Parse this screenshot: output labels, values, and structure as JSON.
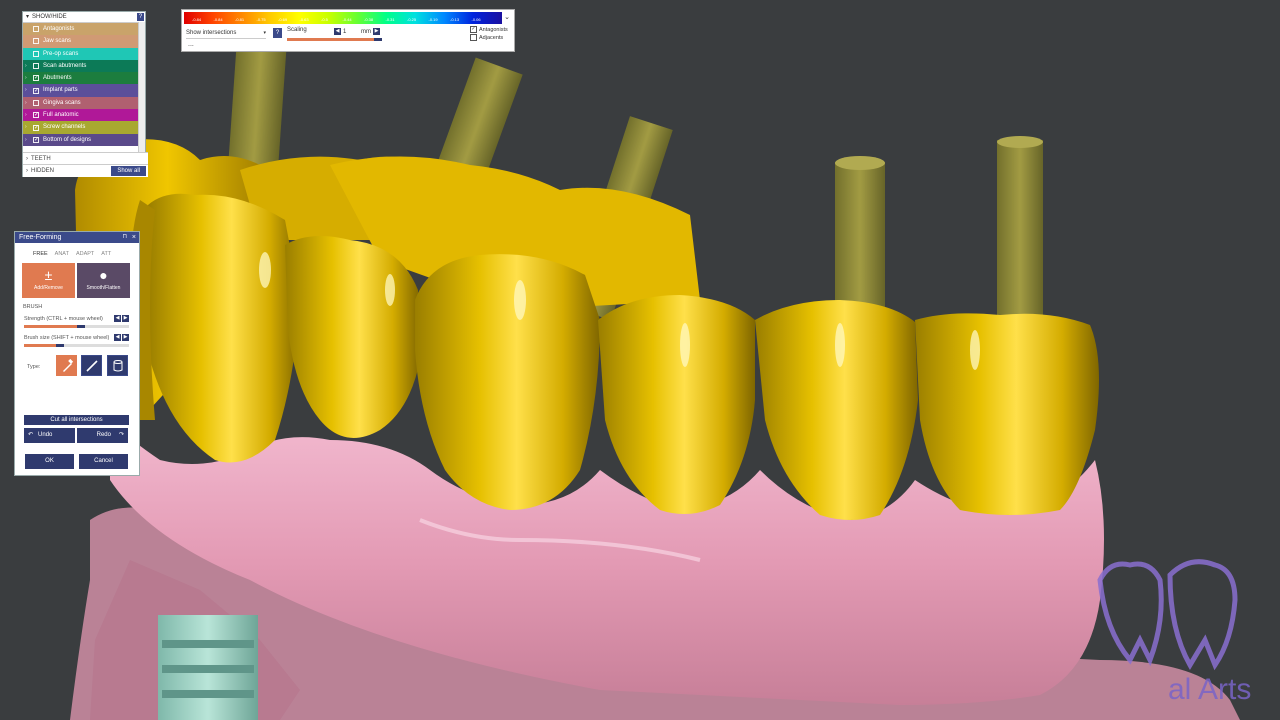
{
  "show_hide": {
    "title": "SHOW/HIDE",
    "help": "?",
    "rows": [
      {
        "label": "Antagonists",
        "color": "#c9a36a",
        "checked": false,
        "has_arrow": false
      },
      {
        "label": "Jaw scans",
        "color": "#d09a74",
        "checked": false,
        "has_arrow": false
      },
      {
        "label": "Pre-op scans",
        "color": "#1fc7b5",
        "checked": false,
        "has_arrow": false
      },
      {
        "label": "Scan abutments",
        "color": "#0c7a57",
        "checked": false,
        "has_arrow": true
      },
      {
        "label": "Abutments",
        "color": "#1c7d3e",
        "checked": true,
        "has_arrow": true
      },
      {
        "label": "Implant parts",
        "color": "#5b4f9a",
        "checked": true,
        "has_arrow": true
      },
      {
        "label": "Gingiva scans",
        "color": "#b06070",
        "checked": false,
        "has_arrow": true
      },
      {
        "label": "Full anatomic",
        "color": "#b01898",
        "checked": true,
        "has_arrow": true
      },
      {
        "label": "Screw channels",
        "color": "#a8a830",
        "checked": true,
        "has_arrow": true
      },
      {
        "label": "Bottom of designs",
        "color": "#5a4a8a",
        "checked": true,
        "has_arrow": true
      }
    ],
    "section_teeth": "TEETH",
    "section_hidden": "HIDDEN",
    "show_all": "Show all"
  },
  "color_panel": {
    "ticks": [
      "-0.84",
      "-0.84",
      "-0.81",
      "-0.75",
      "-0.69",
      "-0.63",
      "-0.5",
      "-0.44",
      "-0.38",
      "-0.31",
      "-0.25",
      "-0.19",
      "-0.13",
      "-0.06"
    ],
    "dropdown_caret": "⌄",
    "select_value": "Show intersections",
    "help": "?",
    "scaling_label": "Scaling",
    "scaling_value": "1",
    "scaling_unit": "mm",
    "antagonists_label": "Antagonists",
    "antagonists_checked": true,
    "adjacents_label": "Adjacents",
    "adjacents_checked": false,
    "ellipsis": "..."
  },
  "free_forming": {
    "title": "Free-Forming",
    "pin": "⊓",
    "close": "×",
    "tabs": [
      "FREE",
      "ANAT",
      "ADAPT",
      "ATT"
    ],
    "modes": [
      {
        "label": "Add/Remove",
        "symbol": "±"
      },
      {
        "label": "Smooth/Flatten",
        "symbol": "●"
      }
    ],
    "brush_label": "BRUSH",
    "strength_label": "Strength (CTRL + mouse wheel)",
    "strength_value": 0.5,
    "size_label": "Brush size (SHIFT + mouse wheel)",
    "size_value": 0.3,
    "type_label": "Type:",
    "cut_all": "Cut all intersections",
    "undo": "Undo",
    "redo": "Redo",
    "ok": "OK",
    "cancel": "Cancel"
  },
  "watermark": {
    "text": "al Arts"
  }
}
